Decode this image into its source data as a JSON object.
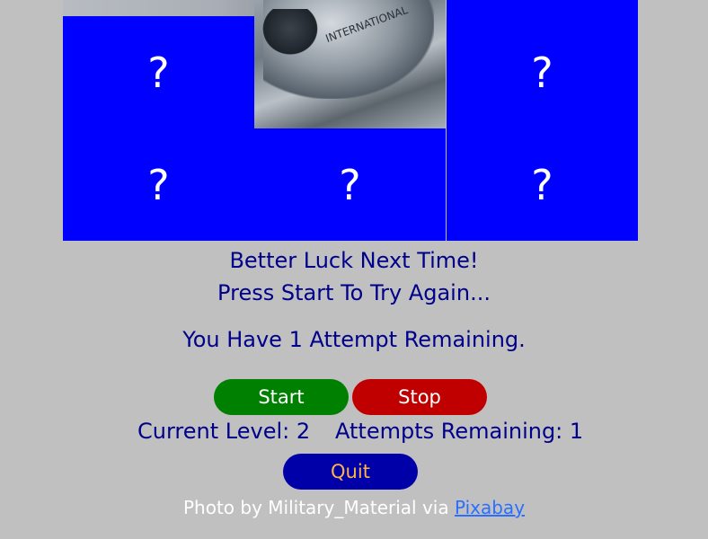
{
  "board": {
    "tiles": [
      {
        "label": "?"
      },
      {
        "label": ""
      },
      {
        "label": "?"
      },
      {
        "label": "?"
      },
      {
        "label": "?"
      },
      {
        "label": "?"
      }
    ],
    "revealed_marking": "INTERNATIONAL"
  },
  "messages": {
    "line1": "Better Luck Next Time!",
    "line2": "Press Start To Try Again...",
    "attempts_notice": "You Have 1 Attempt Remaining."
  },
  "controls": {
    "start_label": "Start",
    "stop_label": "Stop",
    "quit_label": "Quit"
  },
  "status": {
    "level_text": "Current Level: 2",
    "attempts_text": "Attempts Remaining: 1"
  },
  "credit": {
    "prefix": "Photo by Military_Material via",
    "link_text": "Pixabay"
  },
  "colors": {
    "background": "#c0c0c0",
    "tile": "#0000ff",
    "text": "#00008b",
    "start": "#008000",
    "stop": "#c00000",
    "quit": "#0000a8",
    "quit_text": "#ffb347"
  }
}
